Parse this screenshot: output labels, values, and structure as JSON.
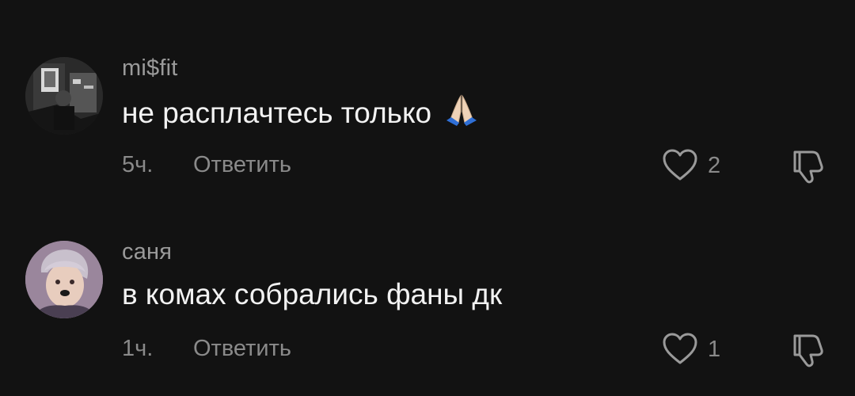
{
  "comments": [
    {
      "username": "mi$fit",
      "text": "не расплачтесь только",
      "emoji": "folded-hands-icon",
      "time": "5ч.",
      "reply_label": "Ответить",
      "likes": "2"
    },
    {
      "username": "саня",
      "text": "в комах собрались фаны дк",
      "time": "1ч.",
      "reply_label": "Ответить",
      "likes": "1"
    }
  ],
  "colors": {
    "background": "#121212",
    "text": "#f2f2f2",
    "secondary": "#8a8a8a"
  }
}
